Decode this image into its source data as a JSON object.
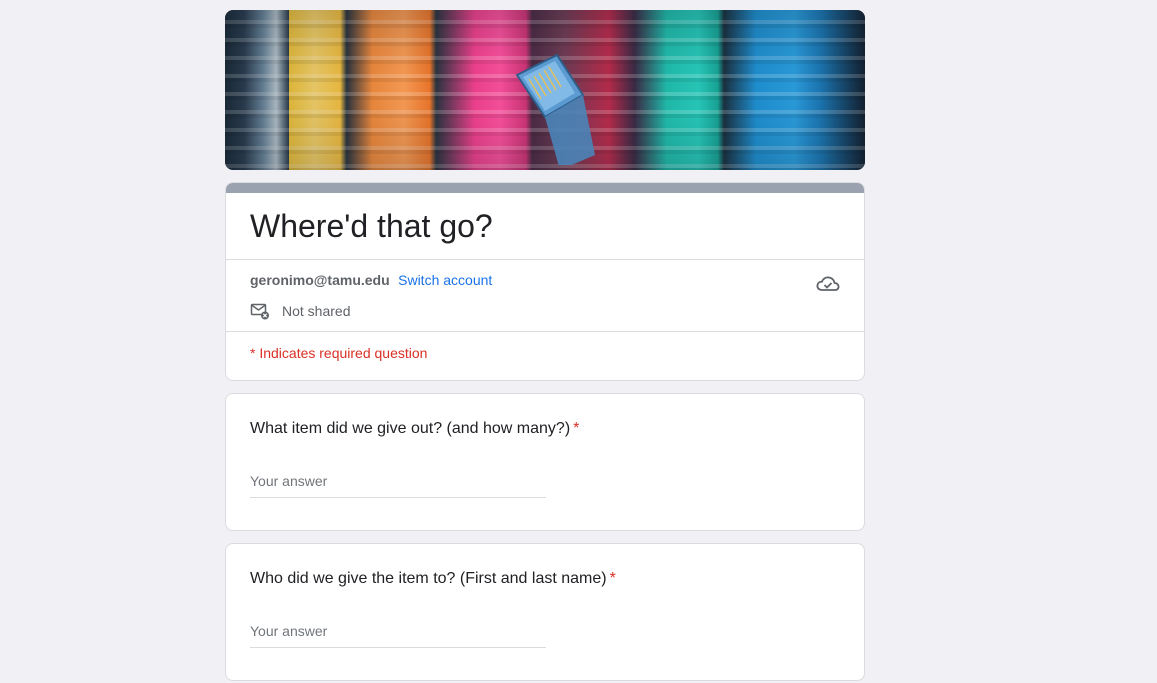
{
  "form": {
    "title": "Where'd that go?",
    "account": {
      "email": "geronimo@tamu.edu",
      "switch_label": "Switch account",
      "share_status": "Not shared"
    },
    "required_note": "* Indicates required question",
    "questions": [
      {
        "text": "What item did we give out? (and how many?)",
        "required_mark": "*",
        "placeholder": "Your answer"
      },
      {
        "text": "Who did we give the item to? (First and last name)",
        "required_mark": "*",
        "placeholder": "Your answer"
      }
    ]
  },
  "icons": {
    "cloud": "cloud-check-icon",
    "mail": "mail-not-shared-icon"
  },
  "colors": {
    "background": "#f0f0f5",
    "accent_bar": "#9aa1af",
    "link": "#1a73e8",
    "required": "#d93025"
  }
}
